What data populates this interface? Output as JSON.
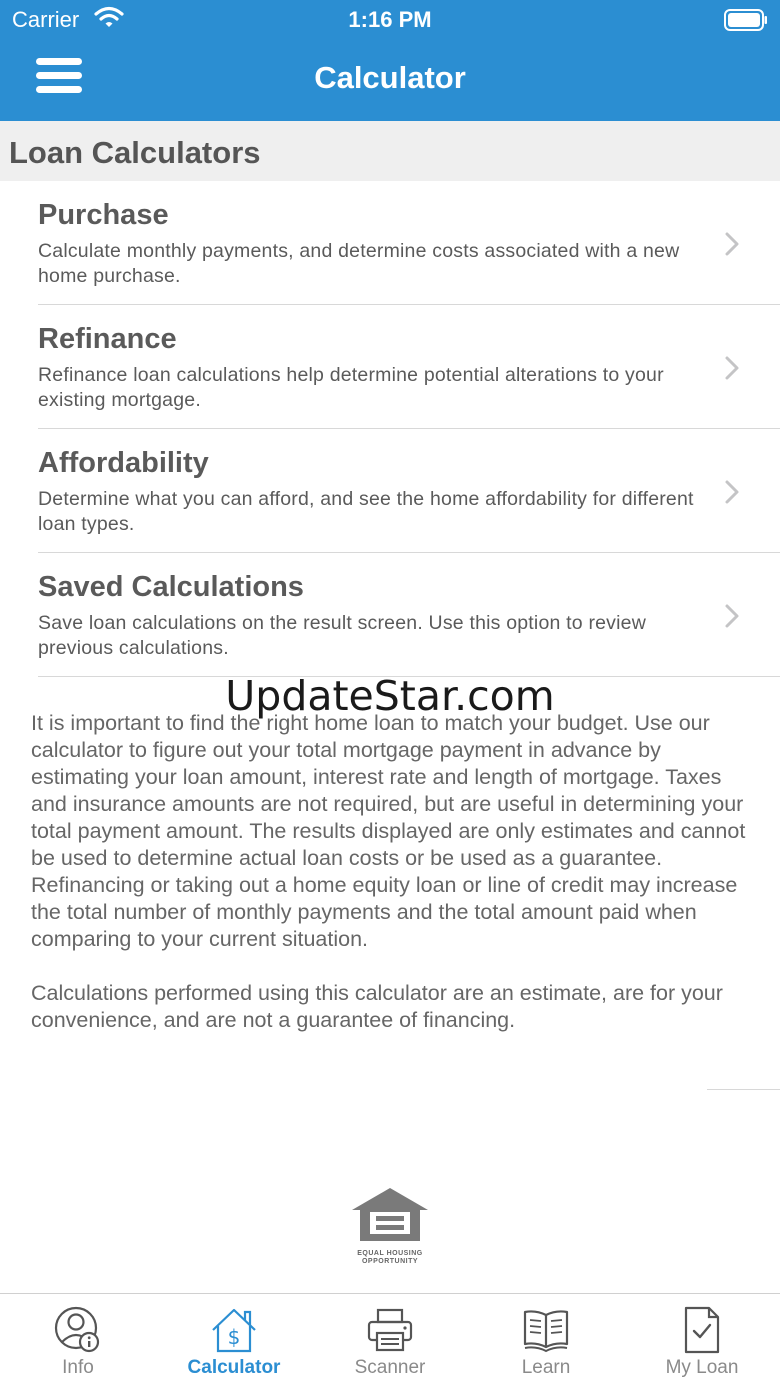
{
  "status": {
    "carrier": "Carrier",
    "time": "1:16 PM"
  },
  "nav": {
    "title": "Calculator"
  },
  "section": {
    "title": "Loan Calculators"
  },
  "calculators": [
    {
      "title": "Purchase",
      "description": "Calculate monthly payments, and determine costs associated with a new home purchase."
    },
    {
      "title": "Refinance",
      "description": "Refinance loan calculations help determine potential alterations to your existing mortgage."
    },
    {
      "title": "Affordability",
      "description": "Determine what you can afford, and see the home affordability for different loan types."
    },
    {
      "title": "Saved Calculations",
      "description": "Save loan calculations on the result screen. Use this option to review previous calculations."
    }
  ],
  "watermark": "UpdateStar.com",
  "disclaimer": {
    "p1": "It is important to find the right home loan to match your budget. Use our calculator to figure out your total mortgage payment in advance by estimating your loan amount, interest rate and length of mortgage. Taxes and insurance amounts are not required, but are useful in determining your total payment amount.  The results displayed are only estimates and cannot be used to determine actual loan costs or be used as a guarantee. Refinancing or taking out a home equity loan or line of credit may increase the total number of monthly payments and the total amount paid when comparing to your current situation.",
    "p2": "Calculations performed using this calculator are an estimate, are for your convenience, and are not a guarantee of financing."
  },
  "logo": {
    "line1": "EQUAL HOUSING",
    "line2": "OPPORTUNITY"
  },
  "tabs": [
    {
      "label": "Info",
      "icon": "user-info-icon",
      "active": false
    },
    {
      "label": "Calculator",
      "icon": "house-dollar-icon",
      "active": true
    },
    {
      "label": "Scanner",
      "icon": "printer-icon",
      "active": false
    },
    {
      "label": "Learn",
      "icon": "book-icon",
      "active": false
    },
    {
      "label": "My Loan",
      "icon": "document-check-icon",
      "active": false
    }
  ],
  "colors": {
    "primary": "#2b8ed2",
    "section_bg": "#efefef",
    "text": "#5a5a5a",
    "inactive_tab": "#8a8a8a"
  }
}
